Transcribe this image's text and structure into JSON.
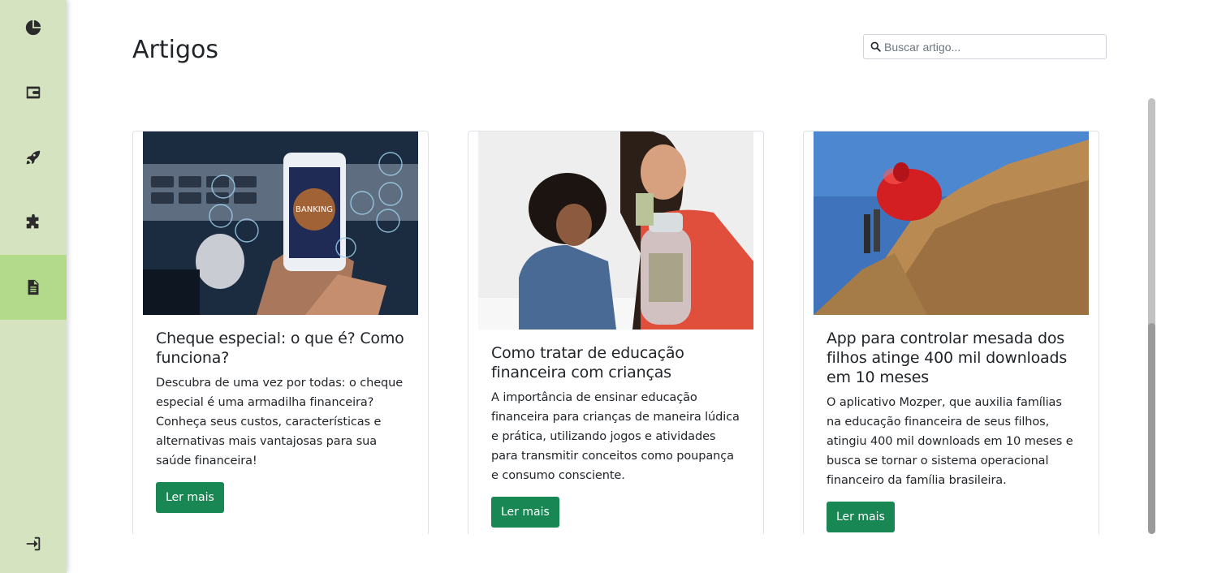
{
  "sidebar": {
    "items": [
      {
        "icon": "pie-chart-icon"
      },
      {
        "icon": "wallet-icon"
      },
      {
        "icon": "rocket-icon"
      },
      {
        "icon": "puzzle-icon"
      },
      {
        "icon": "file-text-icon",
        "active": true
      }
    ],
    "logout_icon": "sign-out-icon",
    "colors": {
      "background": "#d5e3c0",
      "active": "#b3d98a"
    }
  },
  "header": {
    "title": "Artigos",
    "search_placeholder": "Buscar artigo..."
  },
  "articles": [
    {
      "title": "Cheque especial: o que é? Como funciona?",
      "text": "Descubra de uma vez por todas: o cheque especial é uma armadilha financeira? Conheça seus custos, características e alternativas mais vantajosas para sua saúde financeira!",
      "button": "Ler mais",
      "image_label": "BANKING"
    },
    {
      "title": "Como tratar de educação financeira com crianças",
      "text": "A importância de ensinar educação financeira para crianças de maneira lúdica e prática, utilizando jogos e atividades para transmitir conceitos como poupança e consumo consciente.",
      "button": "Ler mais"
    },
    {
      "title": "App para controlar mesada dos filhos atinge 400 mil downloads em 10 meses",
      "text": "O aplicativo Mozper, que auxilia famílias na educação financeira de seus filhos, atingiu 400 mil downloads em 10 meses e busca se tornar o sistema operacional financeiro da família brasileira.",
      "button": "Ler mais"
    }
  ],
  "accent_color": "#198754"
}
